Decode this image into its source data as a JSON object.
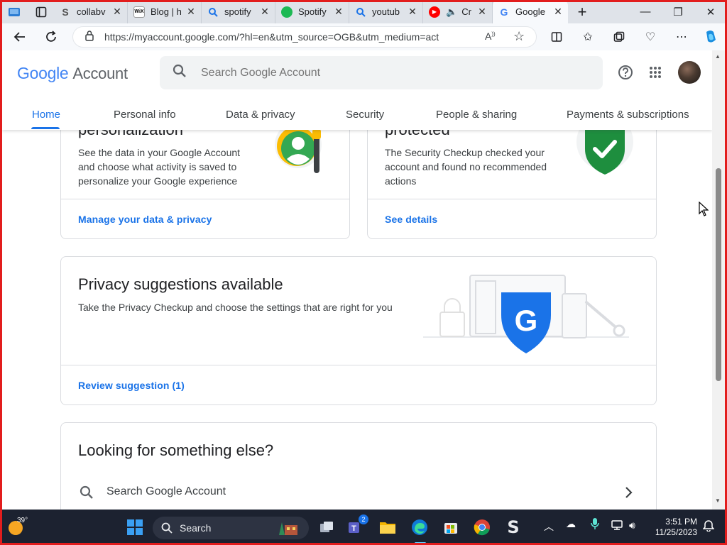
{
  "browser": {
    "tabs": [
      {
        "title": "collabv",
        "favicon": "S",
        "color": "#6b6b6b"
      },
      {
        "title": "Blog | h",
        "favicon": "WiX",
        "color": "#000000"
      },
      {
        "title": "spotify",
        "favicon": "search-icon",
        "color": "#1a73e8"
      },
      {
        "title": "Spotify",
        "favicon": "spotify",
        "color": "#1db954"
      },
      {
        "title": "youtub",
        "favicon": "search-icon",
        "color": "#1a73e8"
      },
      {
        "title": "Cr",
        "favicon": "youtube",
        "color": "#ff0000"
      },
      {
        "title": "Google",
        "favicon": "G",
        "color": "#4285f4",
        "active": true
      }
    ],
    "url": "https://myaccount.google.com/?hl=en&utm_source=OGB&utm_medium=act"
  },
  "header": {
    "logo_google": "Google",
    "logo_account": "Account",
    "search_placeholder": "Search Google Account",
    "nav": [
      {
        "label": "Home",
        "active": true
      },
      {
        "label": "Personal info"
      },
      {
        "label": "Data & privacy"
      },
      {
        "label": "Security"
      },
      {
        "label": "People & sharing"
      },
      {
        "label": "Payments & subscriptions"
      }
    ]
  },
  "cards": {
    "privacy": {
      "title_partial": "personalization",
      "body": "See the data in your Google Account and choose what activity is saved to personalize your Google experience",
      "link": "Manage your data & privacy"
    },
    "security": {
      "title_partial": "protected",
      "body": "The Security Checkup checked your account and found no recommended actions",
      "link": "See details"
    },
    "suggestions": {
      "title": "Privacy suggestions available",
      "body": "Take the Privacy Checkup and choose the settings that are right for you",
      "link": "Review suggestion (1)"
    },
    "looking": {
      "title": "Looking for something else?",
      "search_row": "Search Google Account"
    }
  },
  "taskbar": {
    "weather_temp": "39°",
    "search_label": "Search",
    "teams_badge": "2",
    "time": "3:51 PM",
    "date": "11/25/2023"
  },
  "colors": {
    "accent_blue": "#1a73e8",
    "shield_green": "#1e8e3e",
    "frame_red": "#e21d1d"
  }
}
